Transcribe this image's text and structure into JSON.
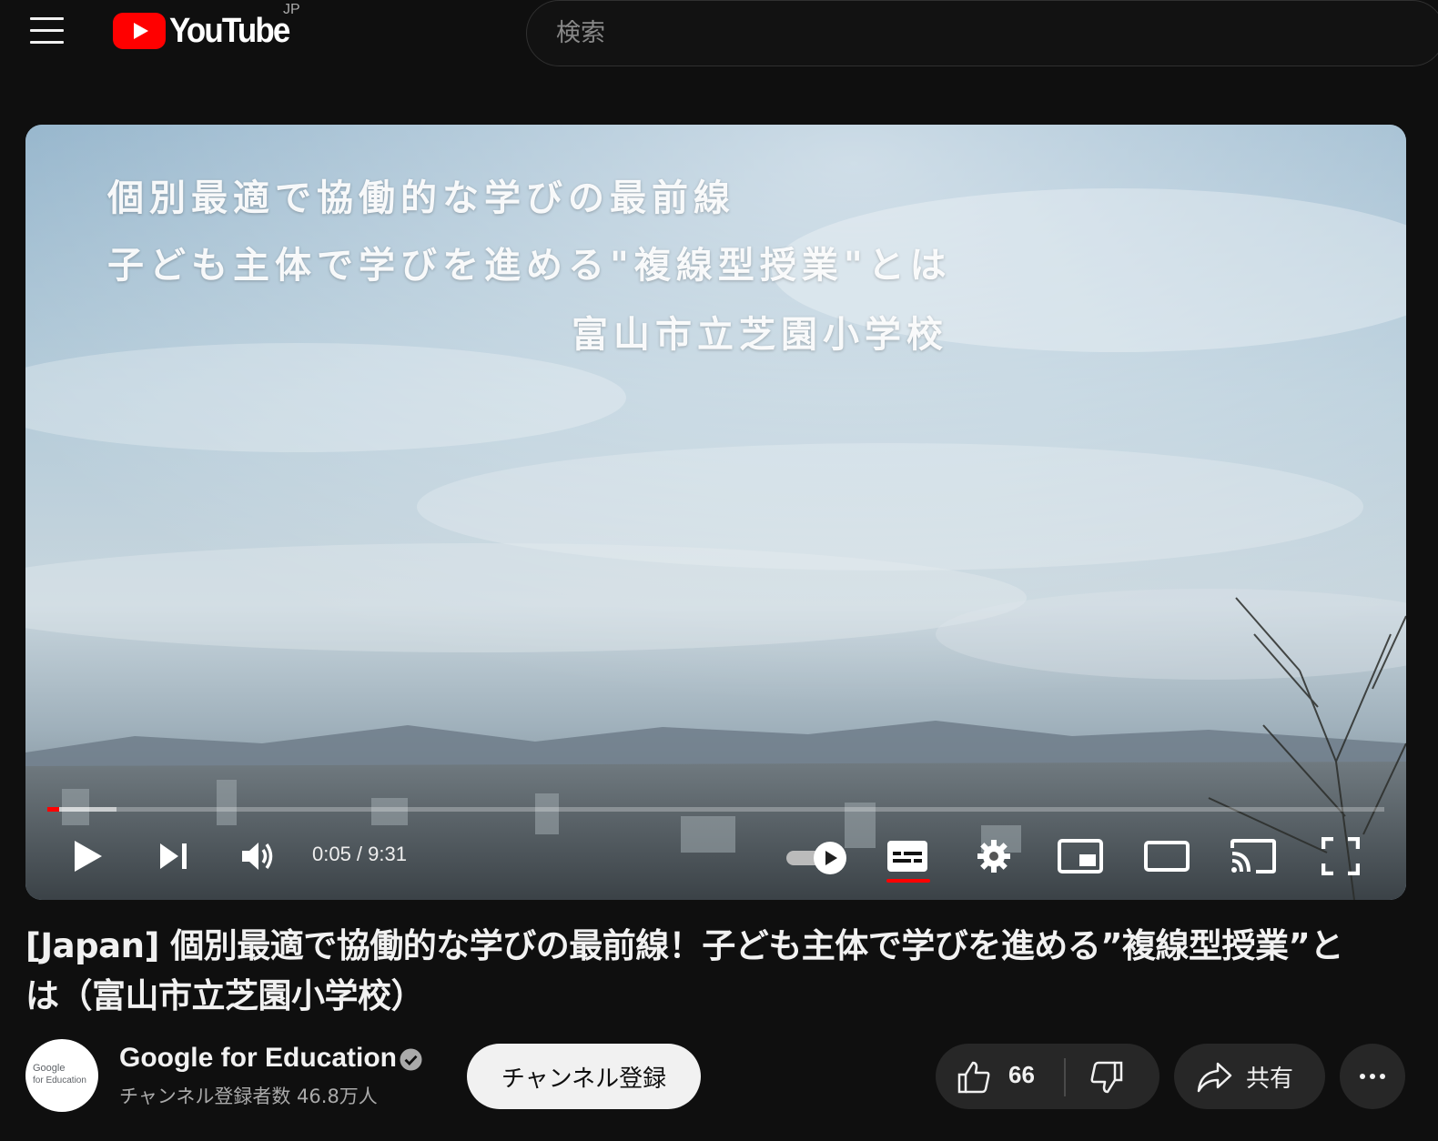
{
  "header": {
    "logo_text": "YouTube",
    "country_code": "JP",
    "search_placeholder": "検索",
    "icons": [
      "menu-icon",
      "youtube-logo"
    ]
  },
  "player": {
    "overlay_lines": [
      "個別最適で協働的な学びの最前線",
      "子ども主体で学びを進める\"複線型授業\"とは",
      "富山市立芝園小学校"
    ],
    "progress_fraction": 0.0088,
    "time_display": "0:05 / 9:31",
    "autoplay_on": true,
    "captions_on": true,
    "controls": [
      "play-icon",
      "next-icon",
      "volume-icon",
      "autoplay-toggle",
      "captions-icon",
      "settings-icon",
      "miniplayer-icon",
      "theater-icon",
      "cast-icon",
      "fullscreen-icon"
    ],
    "accent_color": "#ff0000"
  },
  "video": {
    "title": "[Japan] 個別最適で協働的な学びの最前線！子ども主体で学びを進める”複線型授業”とは（富山市立芝園小学校）"
  },
  "channel": {
    "name": "Google for Education",
    "verified": true,
    "subscribers": "チャンネル登録者数 46.8万人",
    "avatar_line1": "Google",
    "avatar_line2": "for Education",
    "subscribe_label": "チャンネル登録"
  },
  "actions": {
    "like_count": "66",
    "share_label": "共有",
    "icons": [
      "thumbs-up-icon",
      "thumbs-down-icon",
      "share-icon",
      "more-icon"
    ]
  }
}
